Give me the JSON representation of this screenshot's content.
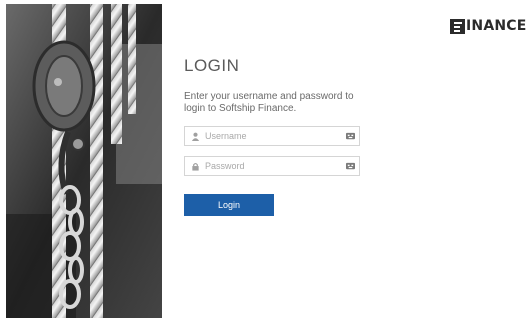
{
  "brand": {
    "name": "INANCE"
  },
  "login": {
    "title": "LOGIN",
    "subtitle": "Enter your username and password to login to Softship Finance.",
    "username_placeholder": "Username",
    "password_placeholder": "Password",
    "button_label": "Login"
  },
  "icons": {
    "username": "user-icon",
    "password": "lock-icon",
    "credential": "keyboard-icon"
  },
  "colors": {
    "accent": "#1d5fa8",
    "brand": "#2b2b2b"
  }
}
